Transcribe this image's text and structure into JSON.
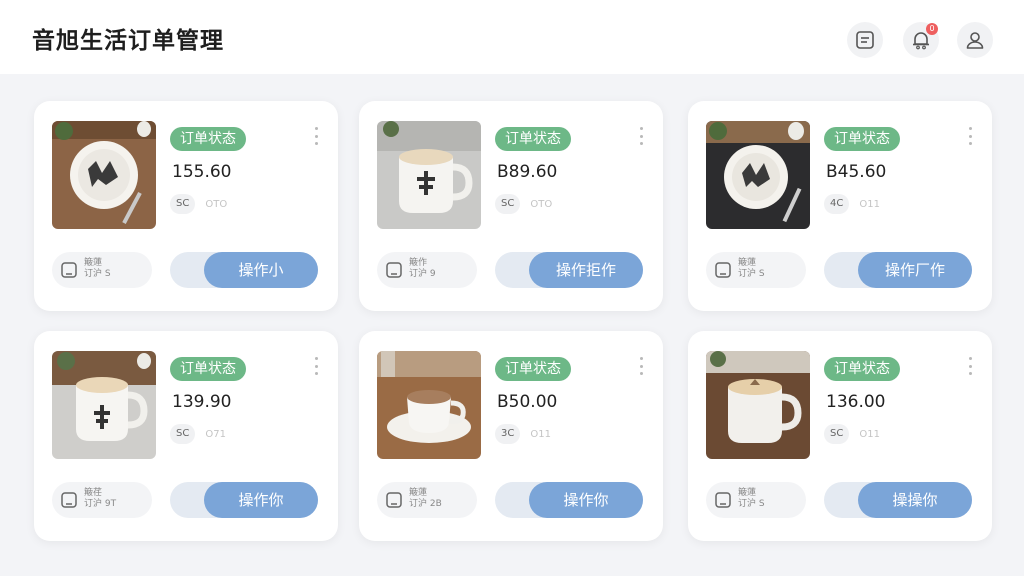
{
  "header": {
    "title": "音旭生活订单管理",
    "notification_count": "0",
    "icons": [
      "message-icon",
      "bell-icon",
      "user-icon"
    ]
  },
  "orders": [
    {
      "status": "订单状态",
      "price": "155.60",
      "chip": "SC",
      "code": "OTO",
      "track_line1": "簸蓮",
      "track_line2": "订沪 S",
      "action": "操作小",
      "image": "plate-with-dessert"
    },
    {
      "status": "订单状态",
      "price": "B89.60",
      "chip": "SC",
      "code": "OTO",
      "track_line1": "簸作",
      "track_line2": "订沪 9",
      "action": "操作拒作",
      "image": "white-mug"
    },
    {
      "status": "订单状态",
      "price": "B45.60",
      "chip": "4C",
      "code": "O11",
      "track_line1": "簸蓮",
      "track_line2": "订沪 S",
      "action": "操作厂作",
      "image": "plate-on-dark-cloth"
    },
    {
      "status": "订单状态",
      "price": "139.90",
      "chip": "SC",
      "code": "O71",
      "track_line1": "簸荏",
      "track_line2": "订沪 9T",
      "action": "操作你",
      "image": "white-mug-latte"
    },
    {
      "status": "订单状态",
      "price": "B50.00",
      "chip": "3C",
      "code": "O11",
      "track_line1": "簸蓮",
      "track_line2": "订沪 2B",
      "action": "操作你",
      "image": "coffee-cup-saucer"
    },
    {
      "status": "订单状态",
      "price": "136.00",
      "chip": "SC",
      "code": "O11",
      "track_line1": "簸蓮",
      "track_line2": "订沪 S",
      "action": "操操你",
      "image": "latte-mug-wood"
    }
  ],
  "colors": {
    "status_green": "#6db887",
    "action_blue": "#7ba5d8",
    "toggle_track": "#e4eaf2",
    "badge_red": "#ee5f5f"
  }
}
